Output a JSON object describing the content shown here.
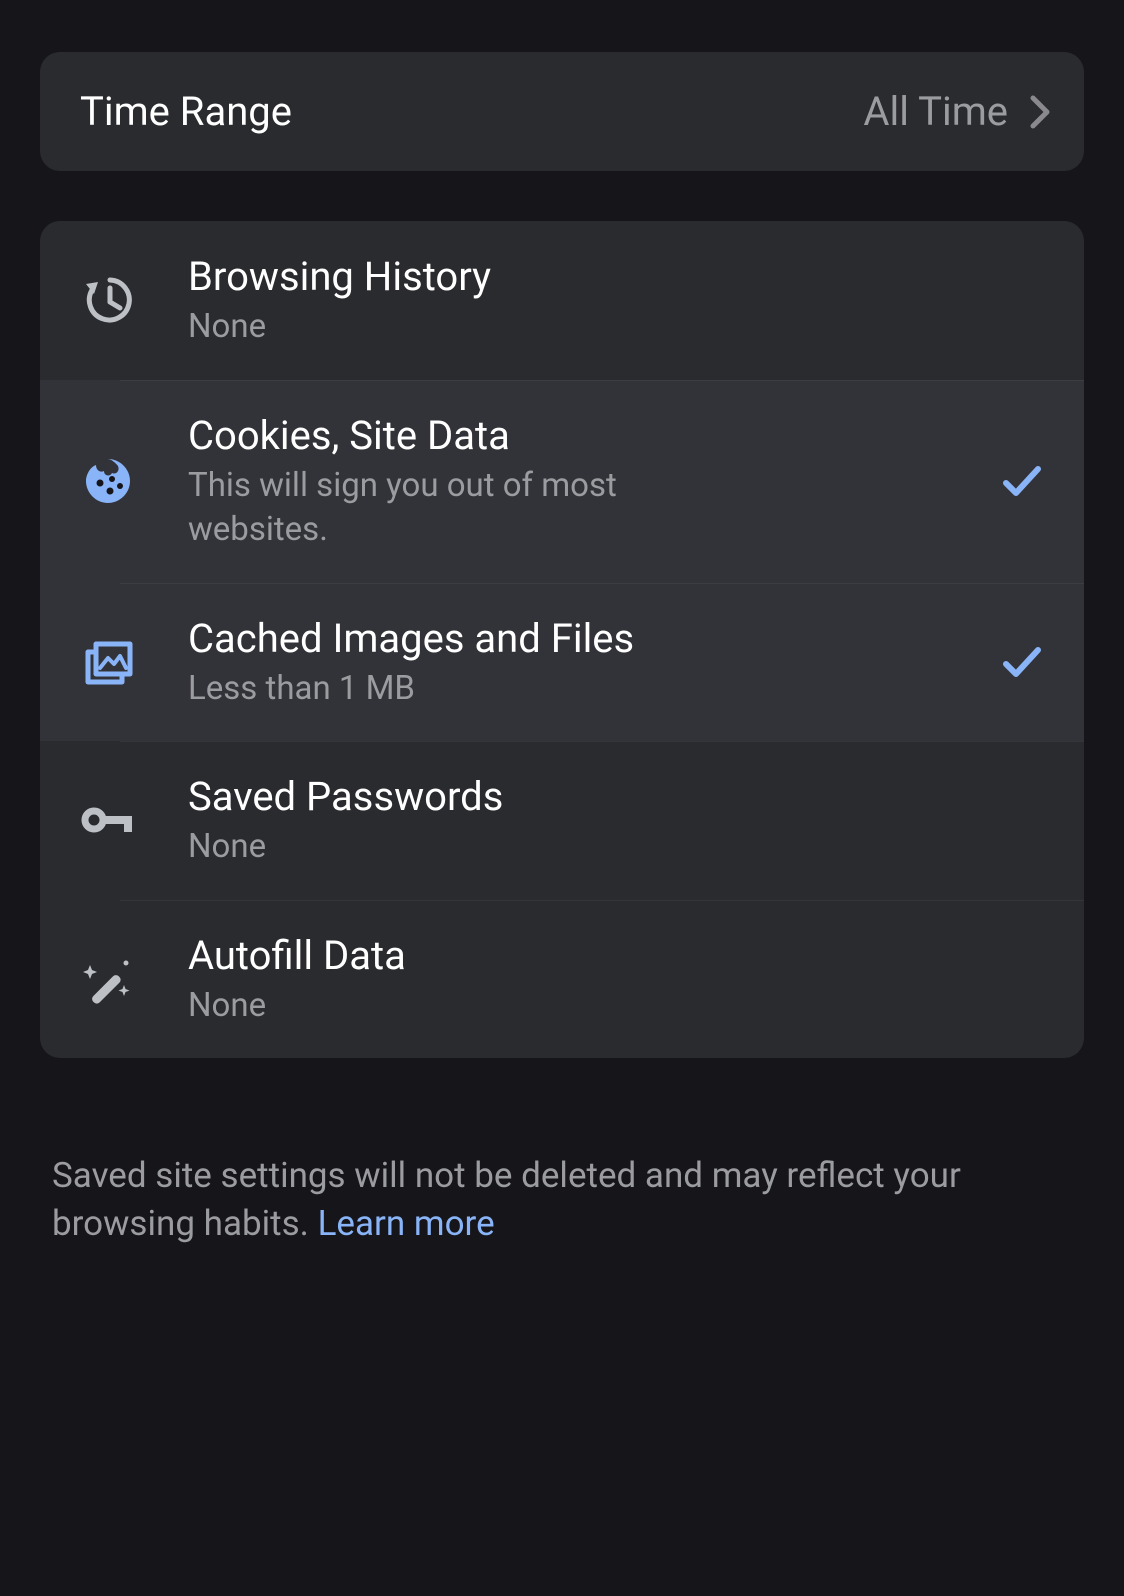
{
  "colors": {
    "accent": "#8ab4f8",
    "muted": "#9b9ca0",
    "iconGrey": "#bdc1c6"
  },
  "timeRange": {
    "label": "Time Range",
    "value": "All Time"
  },
  "items": [
    {
      "id": "browsing-history",
      "icon": "history-icon",
      "title": "Browsing History",
      "subtitle": "None",
      "selected": false
    },
    {
      "id": "cookies",
      "icon": "cookie-icon",
      "title": "Cookies, Site Data",
      "subtitle": "This will sign you out of most websites.",
      "selected": true
    },
    {
      "id": "cached",
      "icon": "cached-images-icon",
      "title": "Cached Images and Files",
      "subtitle": "Less than 1 MB",
      "selected": true
    },
    {
      "id": "passwords",
      "icon": "key-icon",
      "title": "Saved Passwords",
      "subtitle": "None",
      "selected": false
    },
    {
      "id": "autofill",
      "icon": "magic-wand-icon",
      "title": "Autofill Data",
      "subtitle": "None",
      "selected": false
    }
  ],
  "footer": {
    "text": "Saved site settings will not be deleted and may reflect your browsing habits. ",
    "link": "Learn more"
  }
}
